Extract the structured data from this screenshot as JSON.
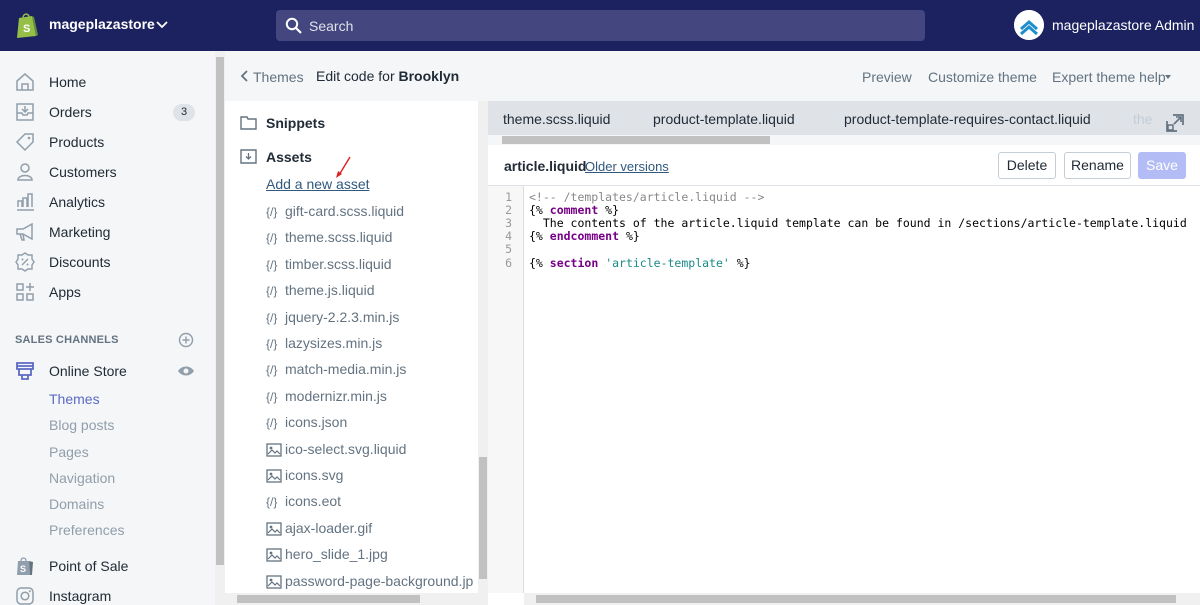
{
  "topbar": {
    "store_name": "mageplazastore",
    "search_placeholder": "Search",
    "admin_name": "mageplazastore Admin",
    "brand_color": "#1c2260"
  },
  "sidebar": {
    "items": [
      {
        "label": "Home",
        "icon": "home-icon"
      },
      {
        "label": "Orders",
        "icon": "orders-icon",
        "badge": "3"
      },
      {
        "label": "Products",
        "icon": "tag-icon"
      },
      {
        "label": "Customers",
        "icon": "person-icon"
      },
      {
        "label": "Analytics",
        "icon": "bar-chart-icon"
      },
      {
        "label": "Marketing",
        "icon": "megaphone-icon"
      },
      {
        "label": "Discounts",
        "icon": "discount-icon"
      },
      {
        "label": "Apps",
        "icon": "apps-icon"
      }
    ],
    "sales_channels_heading": "SALES CHANNELS",
    "online_store": {
      "label": "Online Store",
      "subitems": [
        "Themes",
        "Blog posts",
        "Pages",
        "Navigation",
        "Domains",
        "Preferences"
      ],
      "active": "Themes"
    },
    "point_of_sale": "Point of Sale",
    "instagram": "Instagram"
  },
  "header": {
    "back_label": "Themes",
    "title_prefix": "Edit code for",
    "theme_name": "Brooklyn",
    "links": [
      "Preview",
      "Customize theme",
      "Expert theme help"
    ]
  },
  "tree": {
    "snippets_label": "Snippets",
    "assets_label": "Assets",
    "add_asset_label": "Add a new asset",
    "files": [
      {
        "name": "gift-card.scss.liquid",
        "type": "code"
      },
      {
        "name": "theme.scss.liquid",
        "type": "code"
      },
      {
        "name": "timber.scss.liquid",
        "type": "code"
      },
      {
        "name": "theme.js.liquid",
        "type": "code"
      },
      {
        "name": "jquery-2.2.3.min.js",
        "type": "code"
      },
      {
        "name": "lazysizes.min.js",
        "type": "code"
      },
      {
        "name": "match-media.min.js",
        "type": "code"
      },
      {
        "name": "modernizr.min.js",
        "type": "code"
      },
      {
        "name": "icons.json",
        "type": "code"
      },
      {
        "name": "ico-select.svg.liquid",
        "type": "image"
      },
      {
        "name": "icons.svg",
        "type": "image"
      },
      {
        "name": "icons.eot",
        "type": "code"
      },
      {
        "name": "ajax-loader.gif",
        "type": "image"
      },
      {
        "name": "hero_slide_1.jpg",
        "type": "image"
      },
      {
        "name": "password-page-background.jp",
        "type": "image"
      }
    ]
  },
  "editor": {
    "tabs": [
      "theme.scss.liquid",
      "product-template.liquid",
      "product-template-requires-contact.liquid",
      "the"
    ],
    "file_name": "article.liquid",
    "older_versions_label": "Older versions",
    "buttons": {
      "delete": "Delete",
      "rename": "Rename",
      "save": "Save"
    },
    "line_numbers": [
      "1",
      "2",
      "3",
      "4",
      "5",
      "6"
    ],
    "code": {
      "l1": "<!-- /templates/article.liquid -->",
      "l2_open": "{% ",
      "l2_kw": "comment",
      "l2_close": " %}",
      "l3": "  The contents of the article.liquid template can be found in /sections/article-template.liquid",
      "l4_open": "{% ",
      "l4_kw": "endcomment",
      "l4_close": " %}",
      "l6_open": "{% ",
      "l6_kw": "section",
      "l6_sp": " ",
      "l6_str": "'article-template'",
      "l6_close": " %}"
    }
  }
}
